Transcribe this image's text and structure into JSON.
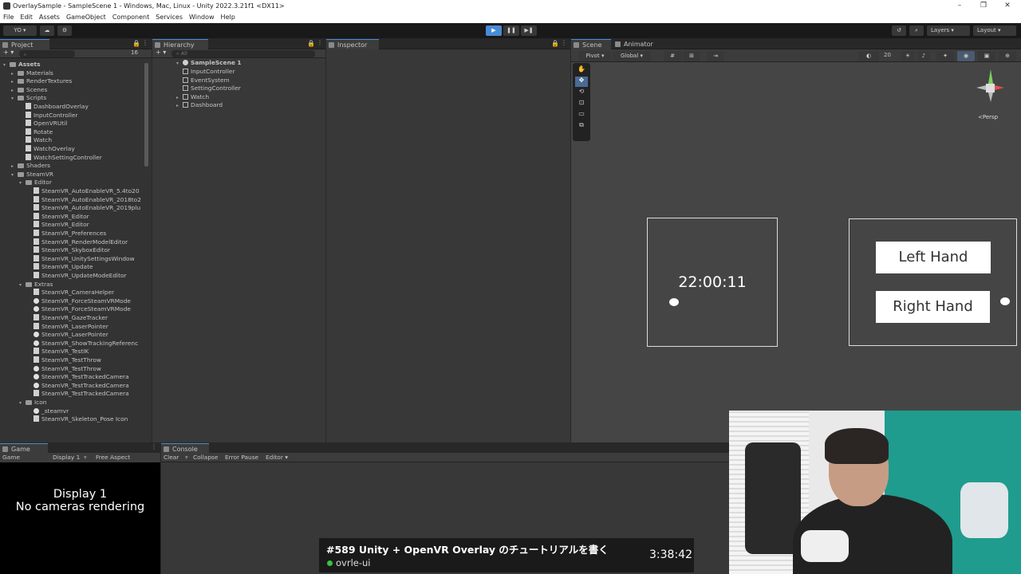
{
  "window": {
    "title": "OverlaySample - SampleScene 1 - Windows, Mac, Linux - Unity 2022.3.21f1 <DX11>",
    "minimize": "–",
    "restore": "❐",
    "close": "✕"
  },
  "menu": [
    "File",
    "Edit",
    "Assets",
    "GameObject",
    "Component",
    "Services",
    "Window",
    "Help"
  ],
  "toolbar": {
    "account": "YO ▾",
    "layers": "Layers",
    "layout": "Layout",
    "play_icon": "▶",
    "pause_icon": "❚❚",
    "step_icon": "▶❚"
  },
  "project": {
    "tab": "Project",
    "search_placeholder": "",
    "count": "16",
    "items": [
      {
        "label": "Assets",
        "depth": 0,
        "icon": "folder",
        "arrow": "▾",
        "bold": true
      },
      {
        "label": "Materials",
        "depth": 1,
        "icon": "folder",
        "arrow": "▸"
      },
      {
        "label": "RenderTextures",
        "depth": 1,
        "icon": "folder",
        "arrow": "▸"
      },
      {
        "label": "Scenes",
        "depth": 1,
        "icon": "folder",
        "arrow": "▸"
      },
      {
        "label": "Scripts",
        "depth": 1,
        "icon": "folder",
        "arrow": "▾"
      },
      {
        "label": "DashboardOverlay",
        "depth": 2,
        "icon": "script"
      },
      {
        "label": "InputController",
        "depth": 2,
        "icon": "script"
      },
      {
        "label": "OpenVRUtil",
        "depth": 2,
        "icon": "script"
      },
      {
        "label": "Rotate",
        "depth": 2,
        "icon": "script"
      },
      {
        "label": "Watch",
        "depth": 2,
        "icon": "script"
      },
      {
        "label": "WatchOverlay",
        "depth": 2,
        "icon": "script"
      },
      {
        "label": "WatchSettingController",
        "depth": 2,
        "icon": "script"
      },
      {
        "label": "Shaders",
        "depth": 1,
        "icon": "folder",
        "arrow": "▸"
      },
      {
        "label": "SteamVR",
        "depth": 1,
        "icon": "folder",
        "arrow": "▾"
      },
      {
        "label": "Editor",
        "depth": 2,
        "icon": "folder",
        "arrow": "▾"
      },
      {
        "label": "SteamVR_AutoEnableVR_5.4to20",
        "depth": 3,
        "icon": "script"
      },
      {
        "label": "SteamVR_AutoEnableVR_2018to2",
        "depth": 3,
        "icon": "script"
      },
      {
        "label": "SteamVR_AutoEnableVR_2019plu",
        "depth": 3,
        "icon": "script"
      },
      {
        "label": "SteamVR_Editor",
        "depth": 3,
        "icon": "script"
      },
      {
        "label": "SteamVR_Editor",
        "depth": 3,
        "icon": "script"
      },
      {
        "label": "SteamVR_Preferences",
        "depth": 3,
        "icon": "script"
      },
      {
        "label": "SteamVR_RenderModelEditor",
        "depth": 3,
        "icon": "script"
      },
      {
        "label": "SteamVR_SkyboxEditor",
        "depth": 3,
        "icon": "script"
      },
      {
        "label": "SteamVR_UnitySettingsWindow",
        "depth": 3,
        "icon": "script"
      },
      {
        "label": "SteamVR_Update",
        "depth": 3,
        "icon": "script"
      },
      {
        "label": "SteamVR_UpdateModeEditor",
        "depth": 3,
        "icon": "script"
      },
      {
        "label": "Extras",
        "depth": 2,
        "icon": "folder",
        "arrow": "▾"
      },
      {
        "label": "SteamVR_CameraHelper",
        "depth": 3,
        "icon": "script"
      },
      {
        "label": "SteamVR_ForceSteamVRMode",
        "depth": 3,
        "icon": "steam"
      },
      {
        "label": "SteamVR_ForceSteamVRMode",
        "depth": 3,
        "icon": "steam"
      },
      {
        "label": "SteamVR_GazeTracker",
        "depth": 3,
        "icon": "script"
      },
      {
        "label": "SteamVR_LaserPointer",
        "depth": 3,
        "icon": "script"
      },
      {
        "label": "SteamVR_LaserPointer",
        "depth": 3,
        "icon": "steam"
      },
      {
        "label": "SteamVR_ShowTrackingReferenc",
        "depth": 3,
        "icon": "steam"
      },
      {
        "label": "SteamVR_TestIK",
        "depth": 3,
        "icon": "script"
      },
      {
        "label": "SteamVR_TestThrow",
        "depth": 3,
        "icon": "script"
      },
      {
        "label": "SteamVR_TestThrow",
        "depth": 3,
        "icon": "steam"
      },
      {
        "label": "SteamVR_TestTrackedCamera",
        "depth": 3,
        "icon": "steam"
      },
      {
        "label": "SteamVR_TestTrackedCamera",
        "depth": 3,
        "icon": "steam"
      },
      {
        "label": "SteamVR_TestTrackedCamera",
        "depth": 3,
        "icon": "script"
      },
      {
        "label": "Icon",
        "depth": 2,
        "icon": "folder",
        "arrow": "▾"
      },
      {
        "label": "_steamvr",
        "depth": 3,
        "icon": "steam"
      },
      {
        "label": "SteamVR_Skeleton_Pose Icon",
        "depth": 3,
        "icon": "script"
      }
    ]
  },
  "hierarchy": {
    "tab": "Hierarchy",
    "search_placeholder": "All",
    "scene": "SampleScene 1",
    "items": [
      {
        "label": "InputController",
        "arrow": ""
      },
      {
        "label": "EventSystem",
        "arrow": ""
      },
      {
        "label": "SettingController",
        "arrow": ""
      },
      {
        "label": "Watch",
        "arrow": "▸"
      },
      {
        "label": "Dashboard",
        "arrow": "▸"
      }
    ]
  },
  "inspector": {
    "tab": "Inspector"
  },
  "scene": {
    "tab": "Scene",
    "animator_tab": "Animator",
    "pivot": "Pivot",
    "global": "Global",
    "grid_size": "20",
    "persp": "<Persp",
    "watch_time": "22:00:11",
    "left_hand": "Left Hand",
    "right_hand": "Right Hand"
  },
  "game": {
    "tab": "Game",
    "mode": "Game",
    "display": "Display 1",
    "aspect": "Free Aspect",
    "msg_line1": "Display 1",
    "msg_line2": "No cameras rendering"
  },
  "console": {
    "tab": "Console",
    "clear": "Clear",
    "collapse": "Collapse",
    "error_pause": "Error Pause",
    "editor": "Editor ▾"
  },
  "stream": {
    "title": "#589 Unity + OpenVR Overlay のチュートリアルを書く",
    "channel": "ovrle-ui",
    "elapsed": "3:38:42"
  },
  "colors": {
    "accent": "#4a8bd6",
    "live_dot": "#3ec13e"
  }
}
